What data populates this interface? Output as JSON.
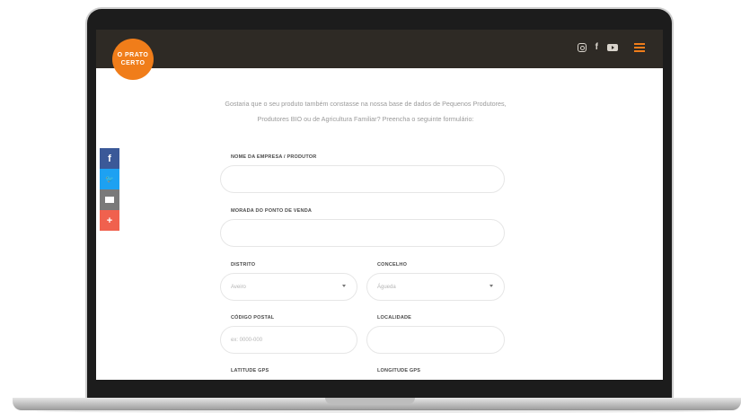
{
  "brand": {
    "logo_line1": "O PRATO",
    "logo_line2": "CERTO",
    "accent_color": "#f07d1a",
    "header_bg": "#2e2a25"
  },
  "header": {
    "icons": [
      "instagram-icon",
      "facebook-icon",
      "youtube-icon",
      "menu-icon"
    ],
    "facebook_glyph": "f"
  },
  "share": {
    "facebook_glyph": "f",
    "twitter_glyph": "🐦",
    "plus_glyph": "+"
  },
  "intro": {
    "line1": "Gostaria que o seu produto também constasse na nossa base de dados de Pequenos Produtores,",
    "line2": "Produtores BIO ou de Agricultura Familiar?  Preencha o seguinte formulário:"
  },
  "form": {
    "company_label": "NOME DA EMPRESA / PRODUTOR",
    "company_value": "",
    "address_label": "MORADA DO PONTO DE VENDA",
    "address_value": "",
    "district_label": "DISTRITO",
    "district_value": "Aveiro",
    "council_label": "CONCELHO",
    "council_value": "Águeda",
    "postal_label": "CÓDIGO POSTAL",
    "postal_placeholder": "ex: 0000-000",
    "locality_label": "LOCALIDADE",
    "locality_value": "",
    "lat_label": "LATITUDE GPS",
    "lon_label": "LONGITUDE GPS"
  }
}
